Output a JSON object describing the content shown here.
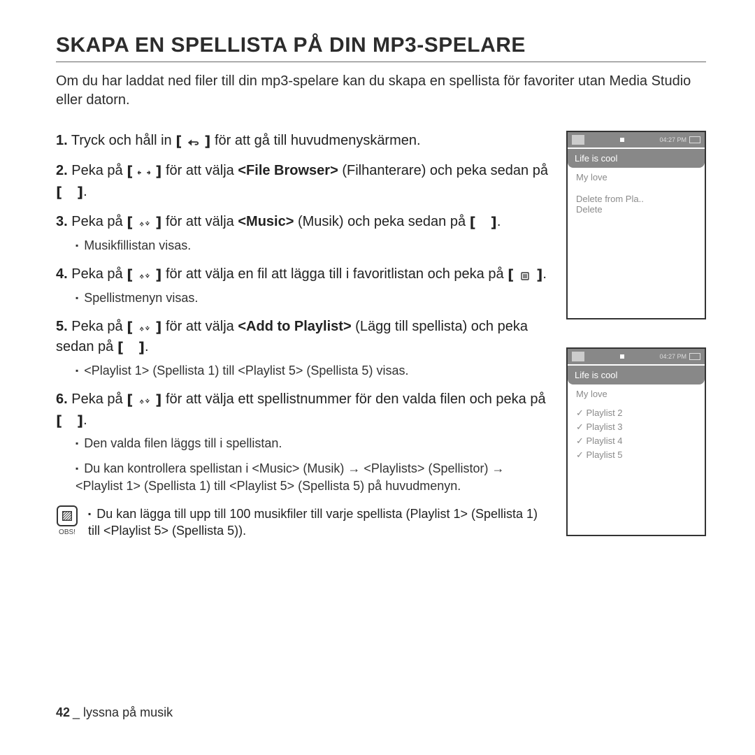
{
  "title": "SKAPA EN SPELLISTA PÅ DIN MP3-SPELARE",
  "intro": "Om du har laddat ned filer till din mp3-spelare kan du skapa en spellista för favoriter utan Media Studio eller datorn.",
  "steps": {
    "s1_a": "Tryck och håll in ",
    "s1_b": " för att gå till huvudmenyskärmen.",
    "s2_a": "Peka på ",
    "s2_b": " för att välja ",
    "s2_bold": "<File Browser>",
    "s2_c": " (Filhanterare) och peka sedan på ",
    "s2_d": ".",
    "s3_a": "Peka på ",
    "s3_b": " för att välja ",
    "s3_bold": "<Music>",
    "s3_c": " (Musik) och peka sedan på ",
    "s3_d": ".",
    "s3_sub": "Musikfillistan visas.",
    "s4_a": "Peka på ",
    "s4_b": " för att välja en fil att lägga till i favoritlistan och peka på ",
    "s4_c": ".",
    "s4_sub": "Spellistmenyn visas.",
    "s5_a": "Peka på ",
    "s5_b": " för att välja ",
    "s5_bold": "<Add to Playlist>",
    "s5_c": " (Lägg till spellista) och peka sedan på ",
    "s5_d": ".",
    "s5_sub": "<Playlist 1> (Spellista 1) till <Playlist 5> (Spellista 5) visas.",
    "s6_a": "Peka på ",
    "s6_b": " för att välja ett spellistnummer för den valda filen och peka på ",
    "s6_c": ".",
    "s6_sub1": "Den valda filen läggs till i spellistan.",
    "s6_sub2": "Du kan kontrollera spellistan i <Music> (Musik) → <Playlists> (Spellistor) → <Playlist 1> (Spellista 1) till <Playlist 5> (Spellista 5) på huvudmenyn."
  },
  "device1": {
    "time": "04:27 PM",
    "selected": "Life is cool",
    "row1": "My love",
    "menu1": "Delete from Pla..",
    "menu2": "Delete"
  },
  "device2": {
    "time": "04:27 PM",
    "selected": "Life is cool",
    "row1": "My love",
    "p2": "Playlist 2",
    "p3": "Playlist 3",
    "p4": "Playlist 4",
    "p5": "Playlist 5"
  },
  "note": {
    "label": "OBS!",
    "text": "Du kan lägga till upp till 100 musikfiler till varje spellista (Playlist 1> (Spellista 1) till <Playlist 5> (Spellista 5))."
  },
  "footer": {
    "page": "42",
    "section": "_ lyssna på musik"
  }
}
